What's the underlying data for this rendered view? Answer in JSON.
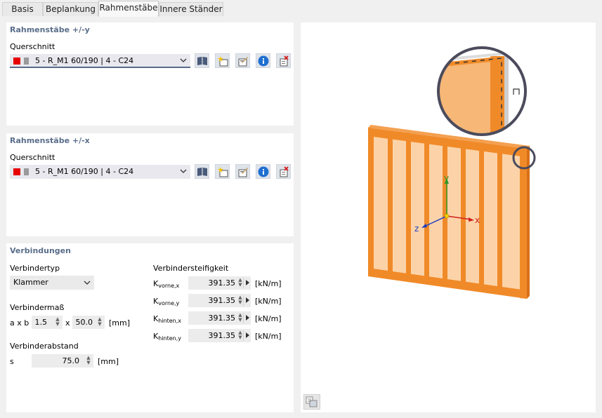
{
  "tabs": [
    {
      "label": "Basis",
      "active": false
    },
    {
      "label": "Beplankung",
      "active": false
    },
    {
      "label": "Rahmenstäbe",
      "active": true
    },
    {
      "label": "Innere Ständer",
      "active": false
    }
  ],
  "frame_y": {
    "title": "Rahmenstäbe +/-y",
    "cross_section_label": "Querschnitt",
    "cross_section_value": "5 - R_M1 60/190 | 4 - C24"
  },
  "frame_x": {
    "title": "Rahmenstäbe +/-x",
    "cross_section_label": "Querschnitt",
    "cross_section_value": "5 - R_M1 60/190 | 4 - C24"
  },
  "connections": {
    "title": "Verbindungen",
    "type_label": "Verbindertyp",
    "type_value": "Klammer",
    "dim_label": "Verbindermaß",
    "axb_label": "a x b",
    "a_value": "1.5",
    "x_sep": "x",
    "b_value": "50.0",
    "dim_unit": "[mm]",
    "spacing_label": "Verbinderabstand",
    "s_label": "s",
    "s_value": "75.0",
    "s_unit": "[mm]",
    "stiffness_label": "Verbindersteifigkeit",
    "stiffness": [
      {
        "k": "K",
        "sub": "vorne,x",
        "value": "391.35",
        "unit": "[kN/m]"
      },
      {
        "k": "K",
        "sub": "vorne,y",
        "value": "391.35",
        "unit": "[kN/m]"
      },
      {
        "k": "K",
        "sub": "hinten,x",
        "value": "391.35",
        "unit": "[kN/m]"
      },
      {
        "k": "K",
        "sub": "hinten,y",
        "value": "391.35",
        "unit": "[kN/m]"
      }
    ]
  },
  "viewer": {
    "axis_x": "x",
    "axis_y": "y",
    "axis_z": "z"
  },
  "colors": {
    "material_red": "#e60000",
    "wood_orange": "#f08a28",
    "wood_light": "#fcd3a8",
    "section_title": "#5a6e8a",
    "info_blue": "#1f6fd0"
  }
}
